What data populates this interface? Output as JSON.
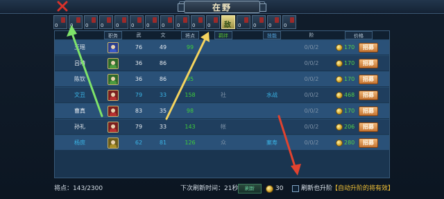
{
  "header": {
    "title": "在野"
  },
  "filters": {
    "items": [
      {
        "count": "0"
      },
      {
        "count": "0"
      },
      {
        "count": "0"
      },
      {
        "count": "0"
      },
      {
        "count": "0"
      },
      {
        "count": "0"
      },
      {
        "count": "0"
      },
      {
        "count": "0"
      },
      {
        "count": "0"
      },
      {
        "count": "0"
      },
      {
        "count": "0"
      },
      {
        "count": "0"
      },
      {
        "count": "0"
      },
      {
        "count": "0"
      },
      {
        "count": "0"
      }
    ],
    "active_label": "敌"
  },
  "table": {
    "headers": {
      "job": "职务",
      "force": "武",
      "intel": "文",
      "points": "将点",
      "slot": "羁绊",
      "skill": "技能",
      "stage": "阶",
      "price": "价格"
    },
    "rows": [
      {
        "name": "王瑶",
        "name_color": "white",
        "avatar": "blue-general",
        "force": "76",
        "intel": "49",
        "points": "99",
        "tag": "",
        "skill": "",
        "stage": "0/0/2",
        "price": "170",
        "action": "招募"
      },
      {
        "name": "吕晴",
        "name_color": "white",
        "avatar": "green-general",
        "force": "36",
        "intel": "86",
        "points": "",
        "tag": "",
        "skill": "",
        "stage": "0/0/2",
        "price": "170",
        "action": "招募"
      },
      {
        "name": "陈钦",
        "name_color": "white",
        "avatar": "green-general",
        "force": "36",
        "intel": "86",
        "points": "95",
        "tag": "",
        "skill": "",
        "stage": "0/0/2",
        "price": "170",
        "action": "招募"
      },
      {
        "name": "文丑",
        "name_color": "cyan",
        "avatar": "red-general",
        "force": "79",
        "intel": "33",
        "points": "158",
        "tag": "社",
        "skill": "水战",
        "stage": "0/0/2",
        "price": "468",
        "action": "招募"
      },
      {
        "name": "曹真",
        "name_color": "white",
        "avatar": "red-general",
        "force": "83",
        "intel": "35",
        "points": "98",
        "tag": "",
        "skill": "",
        "stage": "0/0/2",
        "price": "170",
        "action": "招募"
      },
      {
        "name": "孙礼",
        "name_color": "white",
        "avatar": "red-general",
        "force": "79",
        "intel": "33",
        "points": "143",
        "tag": "帐",
        "skill": "",
        "stage": "0/0/2",
        "price": "206",
        "action": "招募"
      },
      {
        "name": "杨庶",
        "name_color": "cyan",
        "avatar": "yellow-general",
        "force": "62",
        "intel": "81",
        "points": "126",
        "tag": "众",
        "skill": "案寿",
        "stage": "0/0/2",
        "price": "280",
        "action": "招募"
      }
    ]
  },
  "footer": {
    "points_label": "将点：143/2300",
    "refresh_label": "下次刷新时间：21秒",
    "refresh_button": "刷新",
    "refresh_cost": "30",
    "checkbox_label": "刷新也升阶",
    "hint": "【自动升阶的将有效】"
  },
  "colors": {
    "accent_gold": "#f2c136",
    "price_green": "#55d24a",
    "arrow_green": "#7ee36a",
    "arrow_yellow": "#f4d35e",
    "arrow_red": "#e1432f"
  }
}
